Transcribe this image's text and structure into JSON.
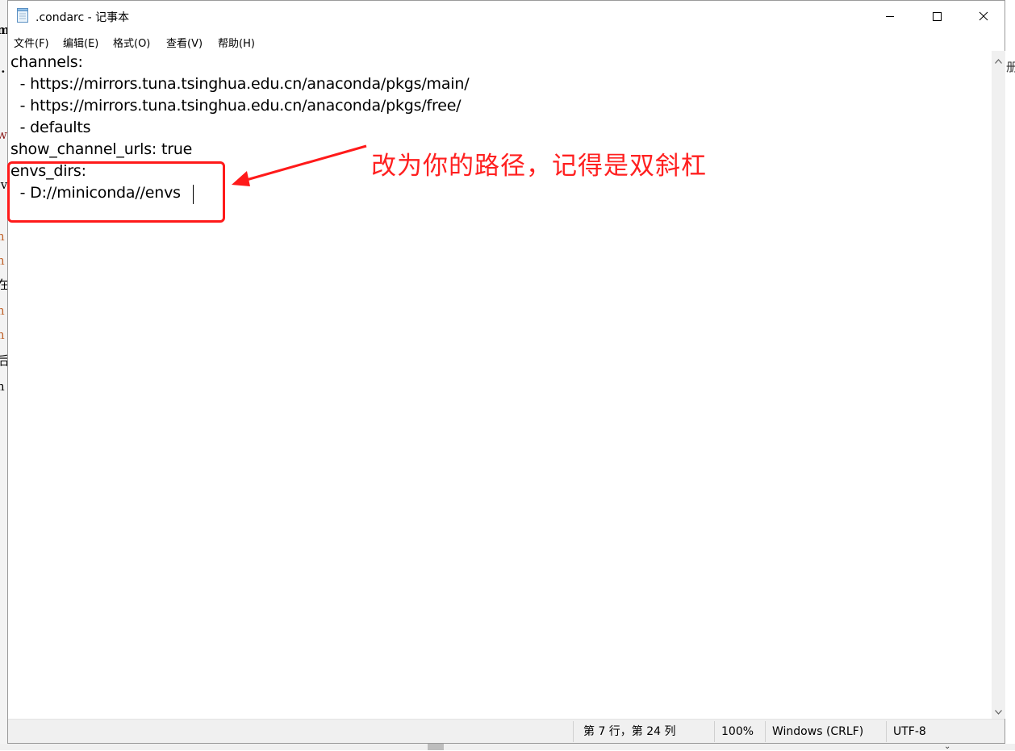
{
  "window": {
    "title": ".condarc - 记事本"
  },
  "menu": [
    {
      "label": "文件(F)"
    },
    {
      "label": "编辑(E)"
    },
    {
      "label": "格式(O)"
    },
    {
      "label": "查看(V)"
    },
    {
      "label": "帮助(H)"
    }
  ],
  "editor": {
    "lines": [
      "channels:",
      "  - https://mirrors.tuna.tsinghua.edu.cn/anaconda/pkgs/main/",
      "  - https://mirrors.tuna.tsinghua.edu.cn/anaconda/pkgs/free/",
      "  - defaults",
      "show_channel_urls: true",
      "envs_dirs:",
      "  - D://miniconda//envs"
    ]
  },
  "status": {
    "position": "第 7 行，第 24 列",
    "zoom": "100%",
    "line_ending": "Windows (CRLF)",
    "encoding": "UTF-8"
  },
  "annotation": {
    "text": "改为你的路径，记得是双斜杠",
    "color": "#ff1a1a"
  },
  "icons": {
    "app": "notepad-icon",
    "minimize": "minimize-icon",
    "maximize": "maximize-icon",
    "close": "close-icon"
  }
}
